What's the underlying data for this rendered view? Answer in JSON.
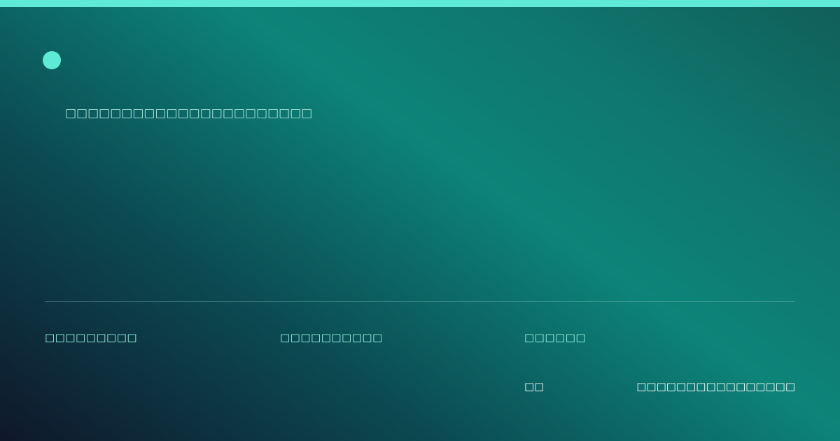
{
  "colors": {
    "accent": "#5eead4",
    "tagline": "#a7e3da",
    "meta": "#99f6e4",
    "footer": "#ffffff"
  },
  "tagline": "□□□□□□□□□□□□□□□□□□□□□□",
  "meta": {
    "item1": "□□□□□□□□□",
    "item2": "□□□□□□□□□□",
    "item3": "□□□□□□"
  },
  "footer": {
    "left": "□□",
    "right": "□□□□□□□□□□□□□□□□"
  }
}
